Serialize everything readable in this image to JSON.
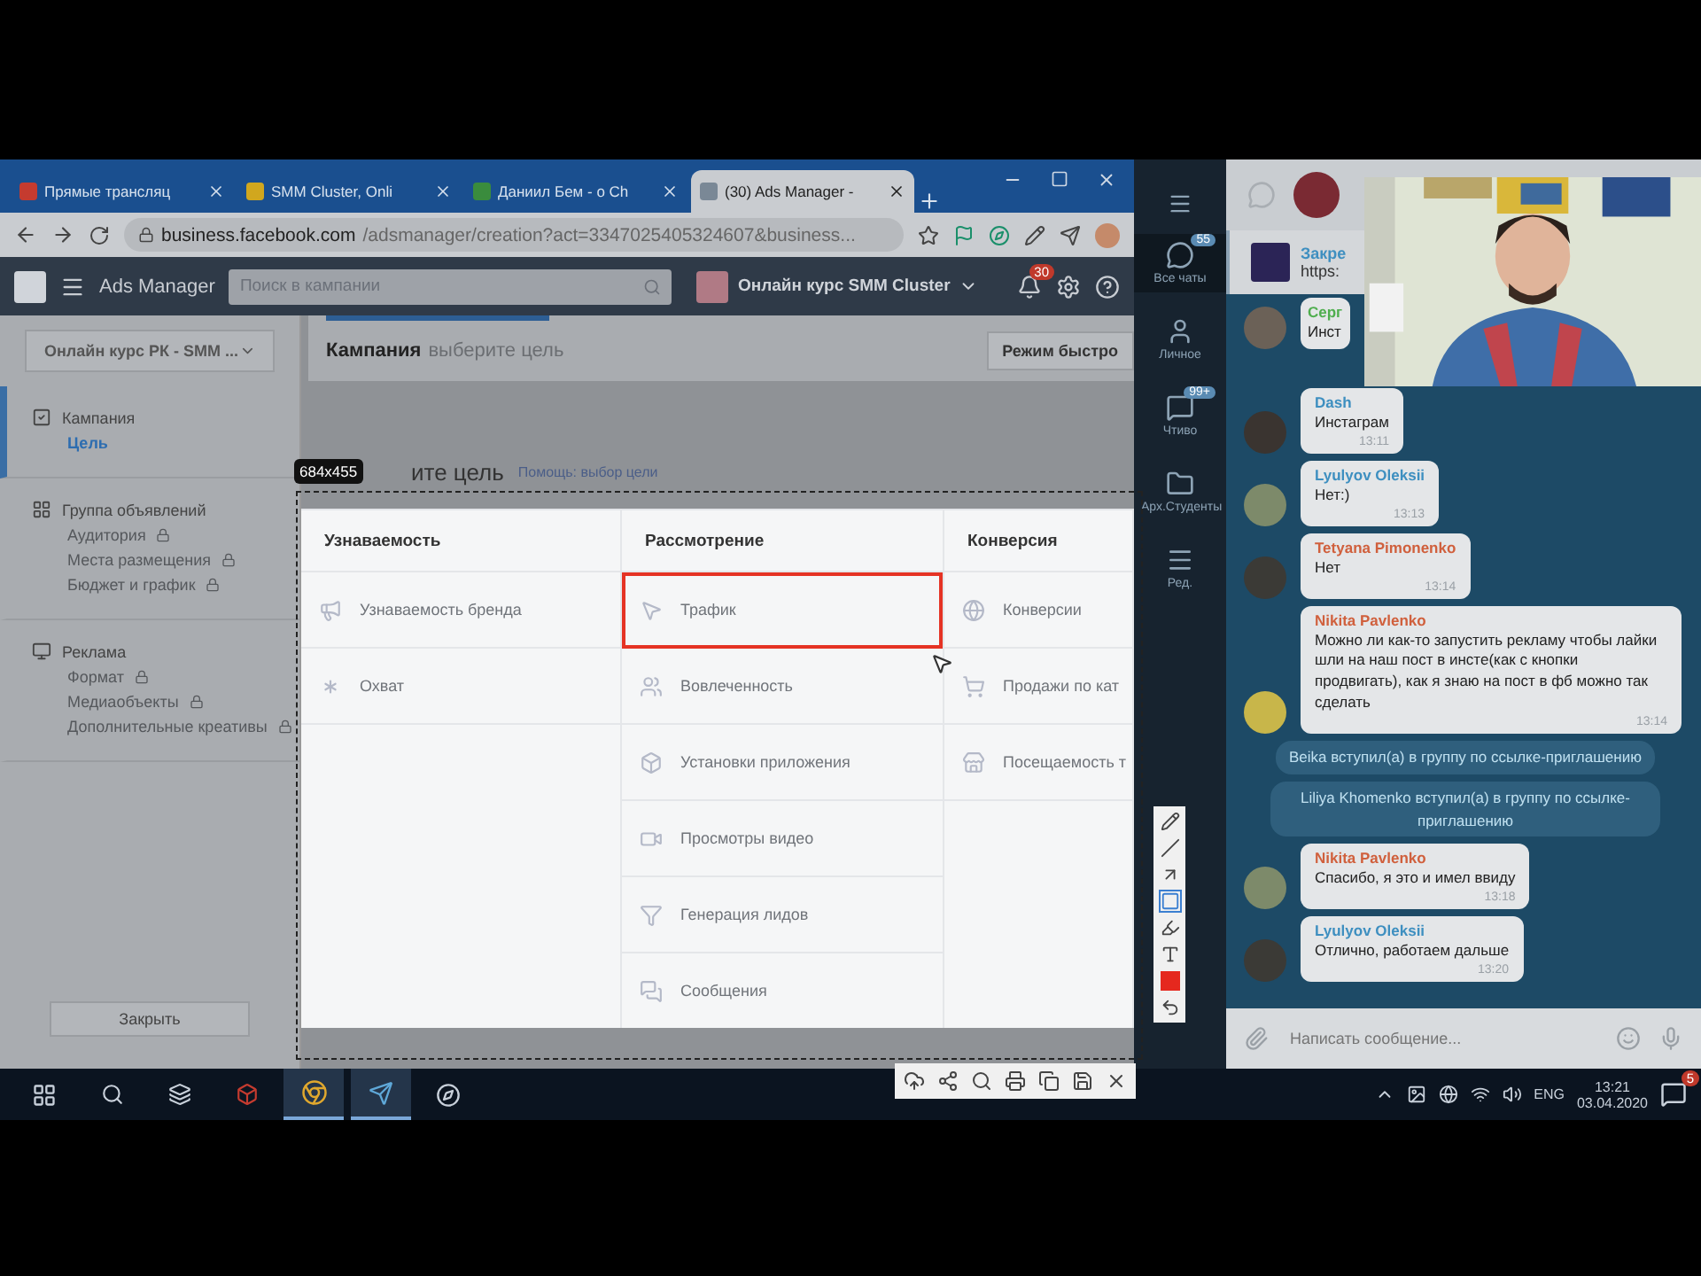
{
  "browser": {
    "tabs": [
      {
        "title": "Прямые трансляц",
        "selected": false
      },
      {
        "title": "SMM Cluster, Onli",
        "selected": false
      },
      {
        "title": "Даниил Бем - о Ch",
        "selected": false
      },
      {
        "title": "(30) Ads Manager -",
        "selected": true
      }
    ],
    "url_host": "business.facebook.com",
    "url_path": "/adsmanager/creation?act=3347025405324607&business..."
  },
  "ads_header": {
    "title": "Ads Manager",
    "search": {
      "placeholder": "Поиск в кампании"
    },
    "account": "Онлайн курс SMM Cluster",
    "notifications": "30"
  },
  "sidebar": {
    "account": "Онлайн курс РК - SMM ...",
    "sections": [
      {
        "title": "Кампания",
        "children": [
          {
            "label": "Цель",
            "selected": true,
            "locked": false
          }
        ]
      },
      {
        "title": "Группа объявлений",
        "children": [
          {
            "label": "Аудитория",
            "selected": false,
            "locked": true
          },
          {
            "label": "Места размещения",
            "selected": false,
            "locked": true
          },
          {
            "label": "Бюджет и график",
            "selected": false,
            "locked": true
          }
        ]
      },
      {
        "title": "Реклама",
        "children": [
          {
            "label": "Формат",
            "selected": false,
            "locked": true
          },
          {
            "label": "Медиаобъекты",
            "selected": false,
            "locked": true
          },
          {
            "label": "Дополнительные креативы",
            "selected": false,
            "locked": true
          }
        ]
      }
    ],
    "close_button": "Закрыть"
  },
  "main": {
    "breadcrumb": "Кампания",
    "breadcrumb_hint": "выберите цель",
    "quick_mode_button": "Режим быстро",
    "heading": "ите цель",
    "help_link": "Помощь: выбор цели",
    "columns": [
      {
        "title": "Узнаваемость",
        "items": [
          {
            "label": "Узнаваемость бренда",
            "highlighted": false
          },
          {
            "label": "Охват",
            "highlighted": false
          }
        ]
      },
      {
        "title": "Рассмотрение",
        "items": [
          {
            "label": "Трафик",
            "highlighted": true
          },
          {
            "label": "Вовлеченность",
            "highlighted": false
          },
          {
            "label": "Установки приложения",
            "highlighted": false
          },
          {
            "label": "Просмотры видео",
            "highlighted": false
          },
          {
            "label": "Генерация лидов",
            "highlighted": false
          },
          {
            "label": "Сообщения",
            "highlighted": false
          }
        ]
      },
      {
        "title": "Конверсия",
        "items": [
          {
            "label": "Конверсии",
            "highlighted": false
          },
          {
            "label": "Продажи по кат",
            "highlighted": false
          },
          {
            "label": "Посещаемость т",
            "highlighted": false
          }
        ]
      }
    ]
  },
  "capture": {
    "size": "684x455"
  },
  "telegram": {
    "folders": [
      {
        "label": "Все чаты",
        "badge": "55",
        "selected": true
      },
      {
        "label": "Личное",
        "selected": false
      },
      {
        "label": "Чтиво",
        "badge": "99+",
        "selected": false
      },
      {
        "label": "Арх.Студенты",
        "selected": false
      },
      {
        "label": "Ред.",
        "selected": false
      }
    ],
    "pinned": {
      "title": "Закре",
      "text": "https:"
    },
    "messages": [
      {
        "kind": "message",
        "author": "Серг",
        "text": "Инст",
        "color": "#4fae4e"
      },
      {
        "kind": "message",
        "author": "Dash",
        "text": "Инстаграм",
        "time": "13:11",
        "color": "#3e8fc0"
      },
      {
        "kind": "message",
        "author": "Lyulyov Oleksii",
        "text": "Нет:)",
        "time": "13:13",
        "color": "#3e8fc0"
      },
      {
        "kind": "message",
        "author": "Tetyana Pimonenko",
        "text": "Нет",
        "time": "13:14",
        "color": "#d0603d"
      },
      {
        "kind": "message",
        "author": "Nikita Pavlenko",
        "text": "Можно ли как-то запустить рекламу чтобы лайки шли на наш пост в инсте(как с кнопки продвигать), как я знаю на пост в фб можно так сделать",
        "time": "13:14",
        "color": "#d0603d"
      },
      {
        "kind": "service",
        "text": "Beika вступил(а) в группу по ссылке-приглашению"
      },
      {
        "kind": "service",
        "text": "Liliya Khomenko вступил(а) в группу по ссылке-приглашению"
      },
      {
        "kind": "message",
        "author": "Nikita Pavlenko",
        "text": "Спасибо, я это и имел ввиду",
        "time": "13:18",
        "color": "#d0603d"
      },
      {
        "kind": "message",
        "author": "Lyulyov Oleksii",
        "text": "Отлично, работаем дальше",
        "time": "13:20",
        "color": "#3e8fc0"
      }
    ],
    "composer": {
      "placeholder": "Написать сообщение..."
    }
  },
  "taskbar": {
    "language": "ENG",
    "time": "13:21",
    "date": "03.04.2020",
    "notifications": "5"
  }
}
